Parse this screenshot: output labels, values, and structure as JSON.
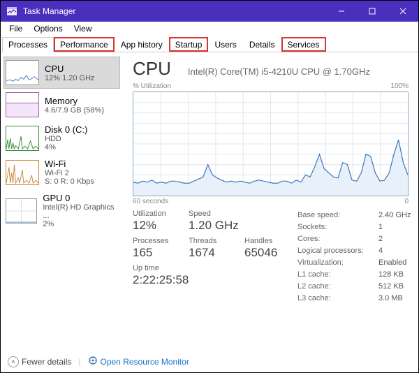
{
  "window": {
    "title": "Task Manager"
  },
  "menu": {
    "file": "File",
    "options": "Options",
    "view": "View"
  },
  "tabs": {
    "processes": "Processes",
    "performance": "Performance",
    "app_history": "App history",
    "startup": "Startup",
    "users": "Users",
    "details": "Details",
    "services": "Services"
  },
  "sidebar": [
    {
      "name": "CPU",
      "sub": "12%  1.20 GHz",
      "color": "cpu"
    },
    {
      "name": "Memory",
      "sub": "4.6/7.9 GB (58%)",
      "color": "mem"
    },
    {
      "name": "Disk 0 (C:)",
      "sub": "HDD",
      "sub2": "4%",
      "color": "disk"
    },
    {
      "name": "Wi-Fi",
      "sub": "Wi-Fi 2",
      "sub2": "S: 0  R: 0 Kbps",
      "color": "wifi"
    },
    {
      "name": "GPU 0",
      "sub": "Intel(R) HD Graphics ...",
      "sub2": "2%",
      "color": "gpu"
    }
  ],
  "main": {
    "title": "CPU",
    "subtitle": "Intel(R) Core(TM) i5-4210U CPU @ 1.70GHz",
    "chart_top_left": "% Utilization",
    "chart_top_right": "100%",
    "chart_bottom_left": "60 seconds",
    "chart_bottom_right": "0"
  },
  "stats": {
    "utilization_label": "Utilization",
    "utilization": "12%",
    "speed_label": "Speed",
    "speed": "1.20 GHz",
    "processes_label": "Processes",
    "processes": "165",
    "threads_label": "Threads",
    "threads": "1674",
    "handles_label": "Handles",
    "handles": "65046",
    "uptime_label": "Up time",
    "uptime": "2:22:25:58"
  },
  "info": {
    "base_speed_label": "Base speed:",
    "base_speed": "2.40 GHz",
    "sockets_label": "Sockets:",
    "sockets": "1",
    "cores_label": "Cores:",
    "cores": "2",
    "lp_label": "Logical processors:",
    "lp": "4",
    "virt_label": "Virtualization:",
    "virt": "Enabled",
    "l1_label": "L1 cache:",
    "l1": "128 KB",
    "l2_label": "L2 cache:",
    "l2": "512 KB",
    "l3_label": "L3 cache:",
    "l3": "3.0 MB"
  },
  "footer": {
    "fewer": "Fewer details",
    "monitor": "Open Resource Monitor"
  },
  "chart_data": {
    "type": "line",
    "title": "CPU % Utilization",
    "ylabel": "% Utilization",
    "xlabel": "60 seconds",
    "ylim": [
      0,
      100
    ],
    "xrange_seconds": 60,
    "values": [
      13,
      12,
      14,
      13,
      15,
      12,
      13,
      12,
      14,
      14,
      13,
      12,
      12,
      14,
      16,
      18,
      30,
      20,
      17,
      15,
      13,
      14,
      13,
      14,
      13,
      12,
      14,
      15,
      14,
      13,
      12,
      12,
      14,
      14,
      12,
      15,
      13,
      20,
      18,
      28,
      40,
      26,
      22,
      18,
      17,
      32,
      30,
      15,
      14,
      22,
      40,
      38,
      22,
      14,
      15,
      22,
      40,
      54,
      32,
      20
    ]
  }
}
